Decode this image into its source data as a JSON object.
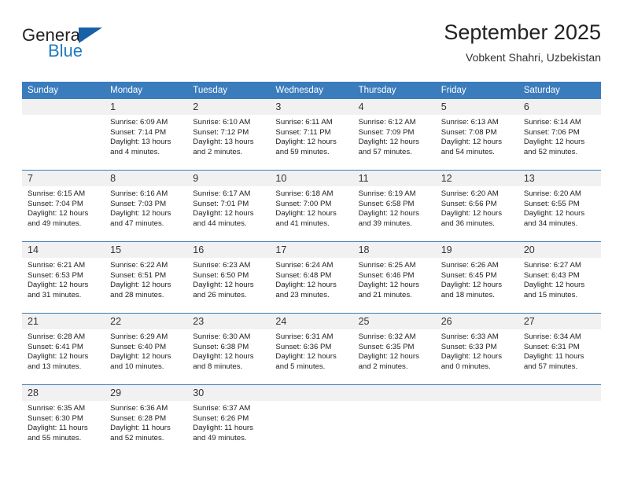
{
  "brand": {
    "name_top": "General",
    "name_bottom": "Blue",
    "triangle_color": "#1761a8",
    "blue_text_color": "#1f7bc1"
  },
  "header": {
    "title": "September 2025",
    "subtitle": "Vobkent Shahri, Uzbekistan",
    "accent_color": "#3b7cbd"
  },
  "calendar": {
    "weekday_headers": [
      "Sunday",
      "Monday",
      "Tuesday",
      "Wednesday",
      "Thursday",
      "Friday",
      "Saturday"
    ],
    "labels": {
      "sunrise": "Sunrise:",
      "sunset": "Sunset:",
      "daylight": "Daylight:"
    },
    "weeks": [
      [
        {
          "day": "",
          "sunrise": "",
          "sunset": "",
          "daylight1": "",
          "daylight2": ""
        },
        {
          "day": "1",
          "sunrise": "Sunrise: 6:09 AM",
          "sunset": "Sunset: 7:14 PM",
          "daylight1": "Daylight: 13 hours",
          "daylight2": "and 4 minutes."
        },
        {
          "day": "2",
          "sunrise": "Sunrise: 6:10 AM",
          "sunset": "Sunset: 7:12 PM",
          "daylight1": "Daylight: 13 hours",
          "daylight2": "and 2 minutes."
        },
        {
          "day": "3",
          "sunrise": "Sunrise: 6:11 AM",
          "sunset": "Sunset: 7:11 PM",
          "daylight1": "Daylight: 12 hours",
          "daylight2": "and 59 minutes."
        },
        {
          "day": "4",
          "sunrise": "Sunrise: 6:12 AM",
          "sunset": "Sunset: 7:09 PM",
          "daylight1": "Daylight: 12 hours",
          "daylight2": "and 57 minutes."
        },
        {
          "day": "5",
          "sunrise": "Sunrise: 6:13 AM",
          "sunset": "Sunset: 7:08 PM",
          "daylight1": "Daylight: 12 hours",
          "daylight2": "and 54 minutes."
        },
        {
          "day": "6",
          "sunrise": "Sunrise: 6:14 AM",
          "sunset": "Sunset: 7:06 PM",
          "daylight1": "Daylight: 12 hours",
          "daylight2": "and 52 minutes."
        }
      ],
      [
        {
          "day": "7",
          "sunrise": "Sunrise: 6:15 AM",
          "sunset": "Sunset: 7:04 PM",
          "daylight1": "Daylight: 12 hours",
          "daylight2": "and 49 minutes."
        },
        {
          "day": "8",
          "sunrise": "Sunrise: 6:16 AM",
          "sunset": "Sunset: 7:03 PM",
          "daylight1": "Daylight: 12 hours",
          "daylight2": "and 47 minutes."
        },
        {
          "day": "9",
          "sunrise": "Sunrise: 6:17 AM",
          "sunset": "Sunset: 7:01 PM",
          "daylight1": "Daylight: 12 hours",
          "daylight2": "and 44 minutes."
        },
        {
          "day": "10",
          "sunrise": "Sunrise: 6:18 AM",
          "sunset": "Sunset: 7:00 PM",
          "daylight1": "Daylight: 12 hours",
          "daylight2": "and 41 minutes."
        },
        {
          "day": "11",
          "sunrise": "Sunrise: 6:19 AM",
          "sunset": "Sunset: 6:58 PM",
          "daylight1": "Daylight: 12 hours",
          "daylight2": "and 39 minutes."
        },
        {
          "day": "12",
          "sunrise": "Sunrise: 6:20 AM",
          "sunset": "Sunset: 6:56 PM",
          "daylight1": "Daylight: 12 hours",
          "daylight2": "and 36 minutes."
        },
        {
          "day": "13",
          "sunrise": "Sunrise: 6:20 AM",
          "sunset": "Sunset: 6:55 PM",
          "daylight1": "Daylight: 12 hours",
          "daylight2": "and 34 minutes."
        }
      ],
      [
        {
          "day": "14",
          "sunrise": "Sunrise: 6:21 AM",
          "sunset": "Sunset: 6:53 PM",
          "daylight1": "Daylight: 12 hours",
          "daylight2": "and 31 minutes."
        },
        {
          "day": "15",
          "sunrise": "Sunrise: 6:22 AM",
          "sunset": "Sunset: 6:51 PM",
          "daylight1": "Daylight: 12 hours",
          "daylight2": "and 28 minutes."
        },
        {
          "day": "16",
          "sunrise": "Sunrise: 6:23 AM",
          "sunset": "Sunset: 6:50 PM",
          "daylight1": "Daylight: 12 hours",
          "daylight2": "and 26 minutes."
        },
        {
          "day": "17",
          "sunrise": "Sunrise: 6:24 AM",
          "sunset": "Sunset: 6:48 PM",
          "daylight1": "Daylight: 12 hours",
          "daylight2": "and 23 minutes."
        },
        {
          "day": "18",
          "sunrise": "Sunrise: 6:25 AM",
          "sunset": "Sunset: 6:46 PM",
          "daylight1": "Daylight: 12 hours",
          "daylight2": "and 21 minutes."
        },
        {
          "day": "19",
          "sunrise": "Sunrise: 6:26 AM",
          "sunset": "Sunset: 6:45 PM",
          "daylight1": "Daylight: 12 hours",
          "daylight2": "and 18 minutes."
        },
        {
          "day": "20",
          "sunrise": "Sunrise: 6:27 AM",
          "sunset": "Sunset: 6:43 PM",
          "daylight1": "Daylight: 12 hours",
          "daylight2": "and 15 minutes."
        }
      ],
      [
        {
          "day": "21",
          "sunrise": "Sunrise: 6:28 AM",
          "sunset": "Sunset: 6:41 PM",
          "daylight1": "Daylight: 12 hours",
          "daylight2": "and 13 minutes."
        },
        {
          "day": "22",
          "sunrise": "Sunrise: 6:29 AM",
          "sunset": "Sunset: 6:40 PM",
          "daylight1": "Daylight: 12 hours",
          "daylight2": "and 10 minutes."
        },
        {
          "day": "23",
          "sunrise": "Sunrise: 6:30 AM",
          "sunset": "Sunset: 6:38 PM",
          "daylight1": "Daylight: 12 hours",
          "daylight2": "and 8 minutes."
        },
        {
          "day": "24",
          "sunrise": "Sunrise: 6:31 AM",
          "sunset": "Sunset: 6:36 PM",
          "daylight1": "Daylight: 12 hours",
          "daylight2": "and 5 minutes."
        },
        {
          "day": "25",
          "sunrise": "Sunrise: 6:32 AM",
          "sunset": "Sunset: 6:35 PM",
          "daylight1": "Daylight: 12 hours",
          "daylight2": "and 2 minutes."
        },
        {
          "day": "26",
          "sunrise": "Sunrise: 6:33 AM",
          "sunset": "Sunset: 6:33 PM",
          "daylight1": "Daylight: 12 hours",
          "daylight2": "and 0 minutes."
        },
        {
          "day": "27",
          "sunrise": "Sunrise: 6:34 AM",
          "sunset": "Sunset: 6:31 PM",
          "daylight1": "Daylight: 11 hours",
          "daylight2": "and 57 minutes."
        }
      ],
      [
        {
          "day": "28",
          "sunrise": "Sunrise: 6:35 AM",
          "sunset": "Sunset: 6:30 PM",
          "daylight1": "Daylight: 11 hours",
          "daylight2": "and 55 minutes."
        },
        {
          "day": "29",
          "sunrise": "Sunrise: 6:36 AM",
          "sunset": "Sunset: 6:28 PM",
          "daylight1": "Daylight: 11 hours",
          "daylight2": "and 52 minutes."
        },
        {
          "day": "30",
          "sunrise": "Sunrise: 6:37 AM",
          "sunset": "Sunset: 6:26 PM",
          "daylight1": "Daylight: 11 hours",
          "daylight2": "and 49 minutes."
        },
        {
          "day": "",
          "sunrise": "",
          "sunset": "",
          "daylight1": "",
          "daylight2": ""
        },
        {
          "day": "",
          "sunrise": "",
          "sunset": "",
          "daylight1": "",
          "daylight2": ""
        },
        {
          "day": "",
          "sunrise": "",
          "sunset": "",
          "daylight1": "",
          "daylight2": ""
        },
        {
          "day": "",
          "sunrise": "",
          "sunset": "",
          "daylight1": "",
          "daylight2": ""
        }
      ]
    ]
  }
}
